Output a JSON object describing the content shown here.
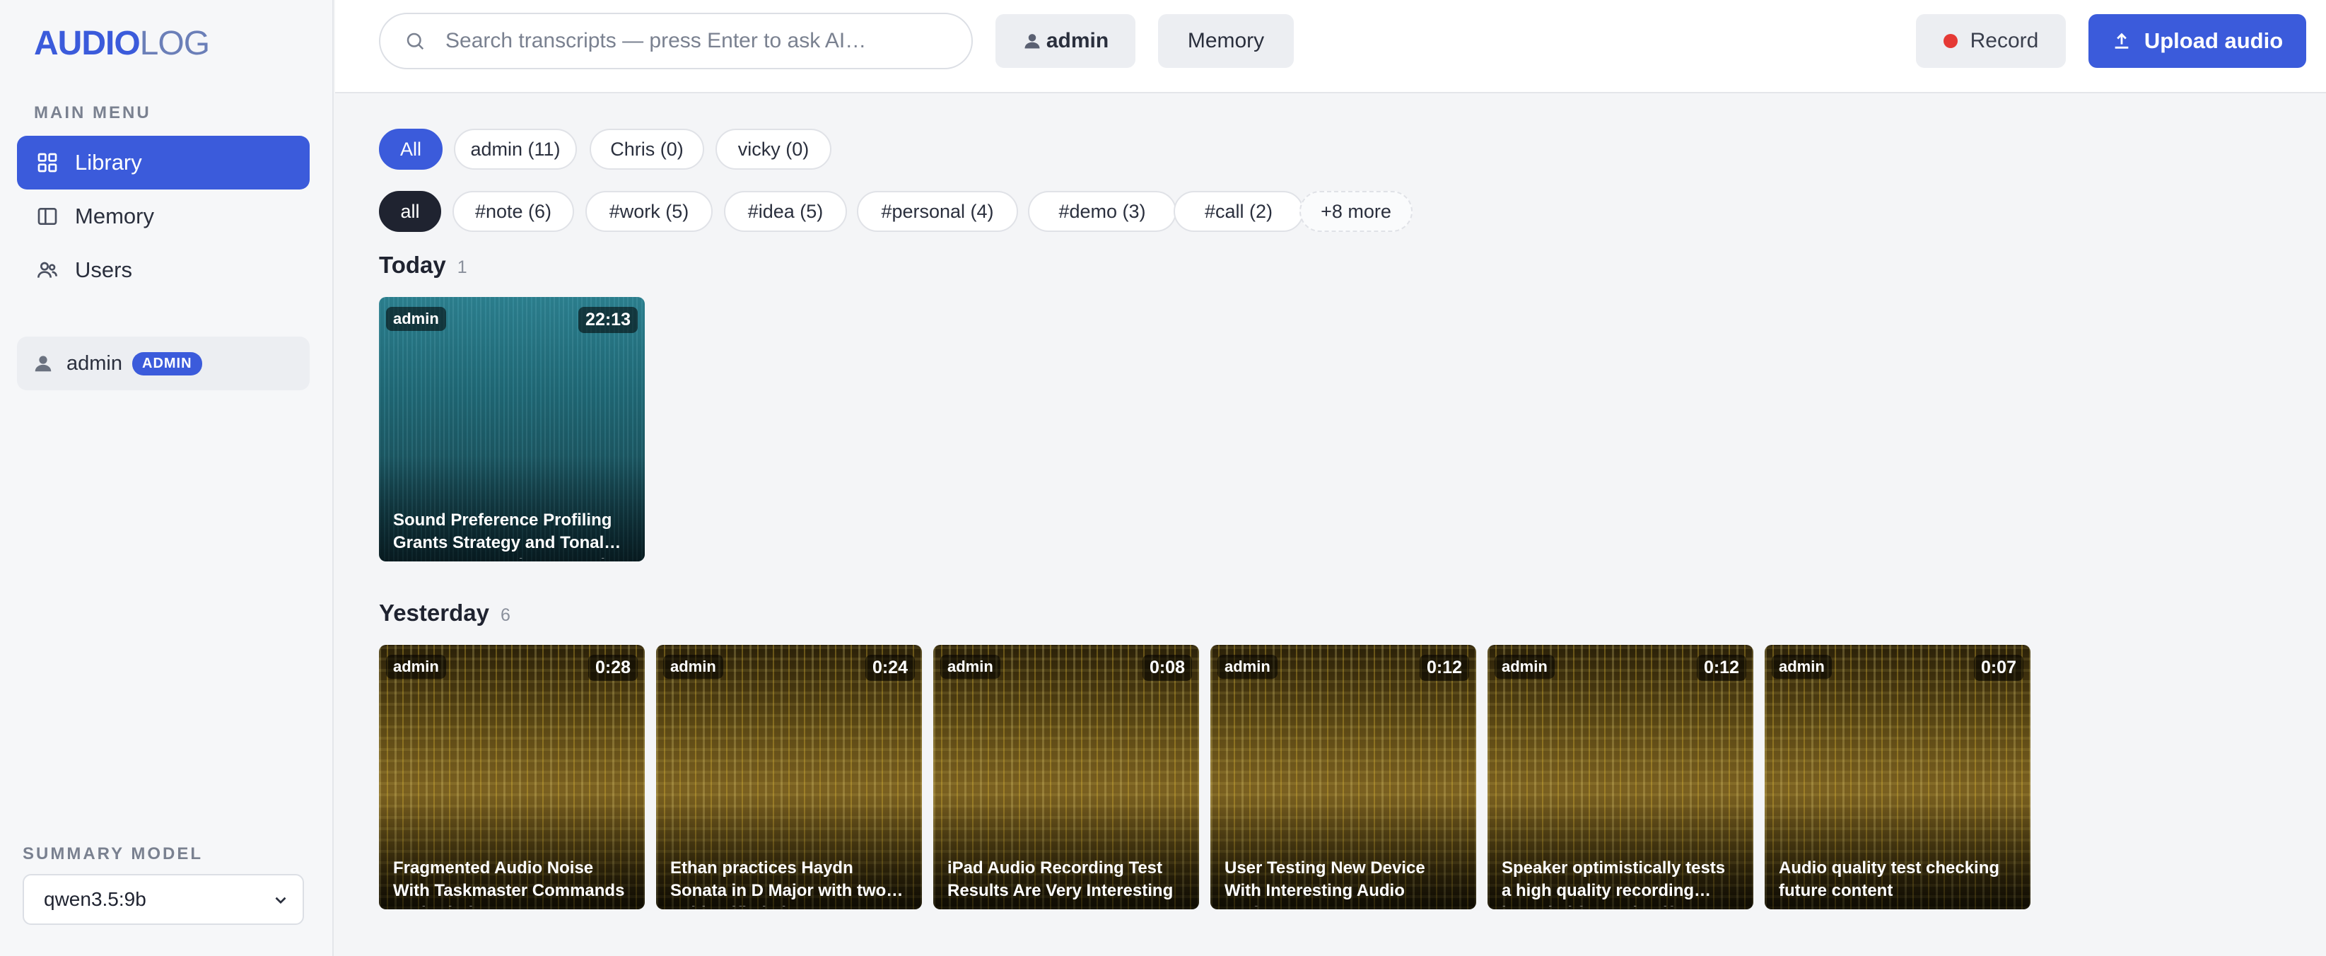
{
  "app": {
    "logo_part1": "AUDIO",
    "logo_part2": "LOG"
  },
  "sidebar": {
    "menu_label": "MAIN MENU",
    "items": [
      {
        "label": "Library",
        "icon": "grid-icon",
        "active": true
      },
      {
        "label": "Memory",
        "icon": "book-icon",
        "active": false
      },
      {
        "label": "Users",
        "icon": "users-icon",
        "active": false
      }
    ],
    "user": {
      "name": "admin",
      "role_badge": "ADMIN"
    },
    "summary_model_label": "SUMMARY MODEL",
    "summary_model_value": "qwen3.5:9b"
  },
  "topbar": {
    "search_placeholder": "Search transcripts — press Enter to ask AI…",
    "user_button": "admin",
    "memory_button": "Memory",
    "record_button": "Record",
    "upload_button": "Upload audio"
  },
  "filters": {
    "users": [
      "All",
      "admin (11)",
      "Chris (0)",
      "vicky (0)"
    ],
    "tags": [
      "all",
      "#note (6)",
      "#work (5)",
      "#idea (5)",
      "#personal (4)",
      "#demo (3)",
      "#call (2)",
      "+8 more"
    ]
  },
  "sections": [
    {
      "title": "Today",
      "count": "1",
      "cards": [
        {
          "owner": "admin",
          "duration": "22:13",
          "title": "Sound Preference Profiling Grants Strategy and Tonal… Language Development Plan"
        }
      ]
    },
    {
      "title": "Yesterday",
      "count": "6",
      "cards": [
        {
          "owner": "admin",
          "duration": "0:28",
          "title": "Fragmented Audio Noise With Taskmaster Commands And… lyrics"
        },
        {
          "owner": "admin",
          "duration": "0:24",
          "title": "Ethan practices Haydn Sonata in D Major with two… unidentified pieces"
        },
        {
          "owner": "admin",
          "duration": "0:08",
          "title": "iPad Audio Recording Test Results Are Very Interesting"
        },
        {
          "owner": "admin",
          "duration": "0:12",
          "title": "User Testing New Device With Interesting Audio Performance"
        },
        {
          "owner": "admin",
          "duration": "0:12",
          "title": "Speaker optimistically tests a high quality recording… intended for saving if own"
        },
        {
          "owner": "admin",
          "duration": "0:07",
          "title": "Audio quality test checking future content"
        }
      ]
    }
  ],
  "colors": {
    "accent": "#3b5bdb",
    "record_dot": "#e53935",
    "today_card": "#1f6673",
    "yesterday_card": "#7a6020"
  }
}
